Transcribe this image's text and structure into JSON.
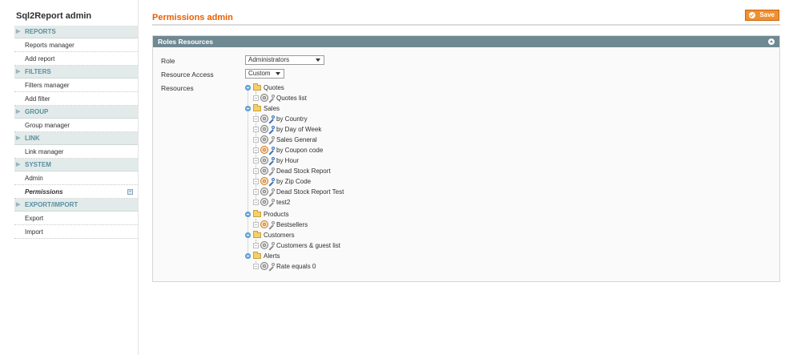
{
  "sidebar": {
    "title": "Sql2Report admin",
    "sections": [
      {
        "label": "REPORTS",
        "items": [
          {
            "label": "Reports manager"
          },
          {
            "label": "Add report"
          }
        ]
      },
      {
        "label": "FILTERS",
        "items": [
          {
            "label": "Filters manager"
          },
          {
            "label": "Add filter"
          }
        ]
      },
      {
        "label": "GROUP",
        "items": [
          {
            "label": "Group manager"
          }
        ]
      },
      {
        "label": "LINK",
        "items": [
          {
            "label": "Link manager"
          }
        ]
      },
      {
        "label": "SYSTEM",
        "items": [
          {
            "label": "Admin"
          },
          {
            "label": "Permissions",
            "active": true
          }
        ]
      },
      {
        "label": "EXPORT/IMPORT",
        "items": [
          {
            "label": "Export"
          },
          {
            "label": "Import"
          }
        ]
      }
    ]
  },
  "header": {
    "title": "Permissions admin",
    "save_label": "Save"
  },
  "panel": {
    "title": "Roles Resources",
    "role_label": "Role",
    "role_value": "Administrators",
    "access_label": "Resource Access",
    "access_value": "Custom",
    "resources_label": "Resources"
  },
  "tree": [
    {
      "label": "Quotes",
      "children": [
        {
          "label": "Quotes list",
          "icon": "gray"
        }
      ]
    },
    {
      "label": "Sales",
      "children": [
        {
          "label": "by Country",
          "icon": "blue"
        },
        {
          "label": "by Day of Week",
          "icon": "blue"
        },
        {
          "label": "Sales General",
          "icon": "gray"
        },
        {
          "label": "by Coupon code",
          "icon": "orange-blue"
        },
        {
          "label": "by Hour",
          "icon": "blue"
        },
        {
          "label": "Dead Stock Report",
          "icon": "gray"
        },
        {
          "label": "by Zip Code",
          "icon": "orange-blue"
        },
        {
          "label": "Dead Stock Report Test",
          "icon": "gray"
        },
        {
          "label": "test2",
          "icon": "gray"
        }
      ]
    },
    {
      "label": "Products",
      "children": [
        {
          "label": "Bestsellers",
          "icon": "orange"
        }
      ]
    },
    {
      "label": "Customers",
      "children": [
        {
          "label": "Customers & guest list",
          "icon": "gray"
        }
      ]
    },
    {
      "label": "Alerts",
      "children": [
        {
          "label": "Rate equals 0",
          "icon": "gray"
        }
      ]
    }
  ],
  "colors": {
    "accent": "#eb5e00",
    "save_button": "#f08f2e",
    "panel_header": "#6f8992",
    "nav_section_bg": "#e2ebea"
  }
}
